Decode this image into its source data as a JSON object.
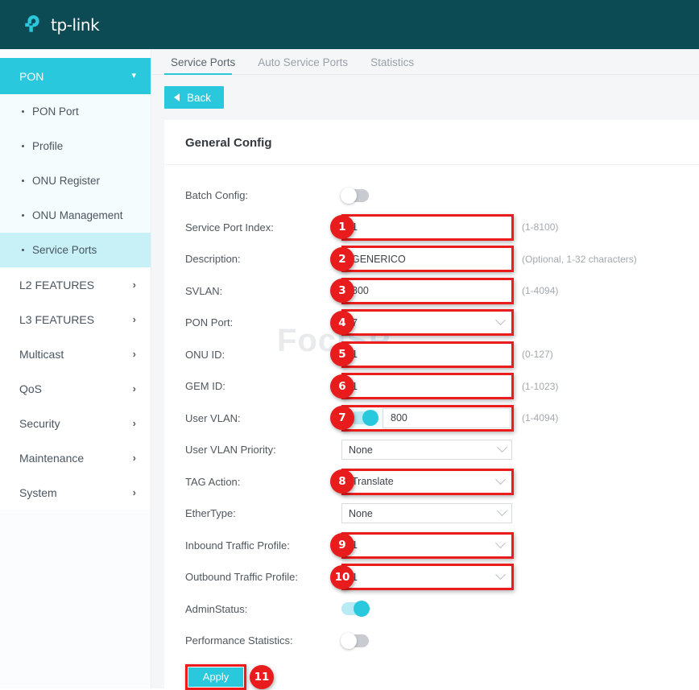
{
  "header": {
    "brand": "tp-link",
    "logo_icon": "tplink-logo-icon",
    "bg": "#0c4a54"
  },
  "watermark": {
    "part1": "Foc",
    "part2": "ISP"
  },
  "sidebar": {
    "group": {
      "label": "PON",
      "icon": "chevron-down-icon",
      "expanded": true
    },
    "sub_items": [
      {
        "label": "PON Port",
        "selected": false
      },
      {
        "label": "Profile",
        "selected": false
      },
      {
        "label": "ONU Register",
        "selected": false
      },
      {
        "label": "ONU Management",
        "selected": false
      },
      {
        "label": "Service Ports",
        "selected": true
      }
    ],
    "items": [
      {
        "label": "L2 FEATURES",
        "icon": "chevron-right-icon"
      },
      {
        "label": "L3 FEATURES",
        "icon": "chevron-right-icon"
      },
      {
        "label": "Multicast",
        "icon": "chevron-right-icon"
      },
      {
        "label": "QoS",
        "icon": "chevron-right-icon"
      },
      {
        "label": "Security",
        "icon": "chevron-right-icon"
      },
      {
        "label": "Maintenance",
        "icon": "chevron-right-icon"
      },
      {
        "label": "System",
        "icon": "chevron-right-icon"
      }
    ]
  },
  "main": {
    "tabs": [
      {
        "label": "Service Ports",
        "active": true
      },
      {
        "label": "Auto Service Ports",
        "active": false
      },
      {
        "label": "Statistics",
        "active": false
      }
    ],
    "back_button": {
      "label": "Back",
      "icon": "triangle-left-icon"
    },
    "card_title": "General Config",
    "fields": {
      "batch_config": {
        "label": "Batch Config:",
        "toggle": "off"
      },
      "service_port_index": {
        "label": "Service Port Index:",
        "value": "1",
        "hint": "(1-8100)",
        "marker": "1"
      },
      "description": {
        "label": "Description:",
        "value": "GENERICO",
        "hint": "(Optional, 1-32 characters)",
        "marker": "2"
      },
      "svlan": {
        "label": "SVLAN:",
        "value": "800",
        "hint": "(1-4094)",
        "marker": "3"
      },
      "pon_port": {
        "label": "PON Port:",
        "value": "7",
        "hint": "",
        "marker": "4"
      },
      "onu_id": {
        "label": "ONU ID:",
        "value": "1",
        "hint": "(0-127)",
        "marker": "5"
      },
      "gem_id": {
        "label": "GEM ID:",
        "value": "1",
        "hint": "(1-1023)",
        "marker": "6"
      },
      "user_vlan": {
        "label": "User VLAN:",
        "toggle": "on",
        "value": "800",
        "hint": "(1-4094)",
        "marker": "7"
      },
      "user_vlan_priority": {
        "label": "User VLAN Priority:",
        "value": "None"
      },
      "tag_action": {
        "label": "TAG Action:",
        "value": "Translate",
        "marker": "8"
      },
      "ethertype": {
        "label": "EtherType:",
        "value": "None"
      },
      "inbound_profile": {
        "label": "Inbound Traffic Profile:",
        "value": "1",
        "marker": "9"
      },
      "outbound_profile": {
        "label": "Outbound Traffic Profile:",
        "value": "1",
        "marker": "10"
      },
      "admin_status": {
        "label": "AdminStatus:",
        "toggle": "on"
      },
      "performance_statistics": {
        "label": "Performance Statistics:",
        "toggle": "off"
      }
    },
    "apply_button": {
      "label": "Apply",
      "marker": "11"
    }
  },
  "colors": {
    "accent": "#2ac8dd",
    "header_bg": "#0c4a54",
    "highlight": "#ec1c1c",
    "selected_nav": "#c7f0f7"
  }
}
